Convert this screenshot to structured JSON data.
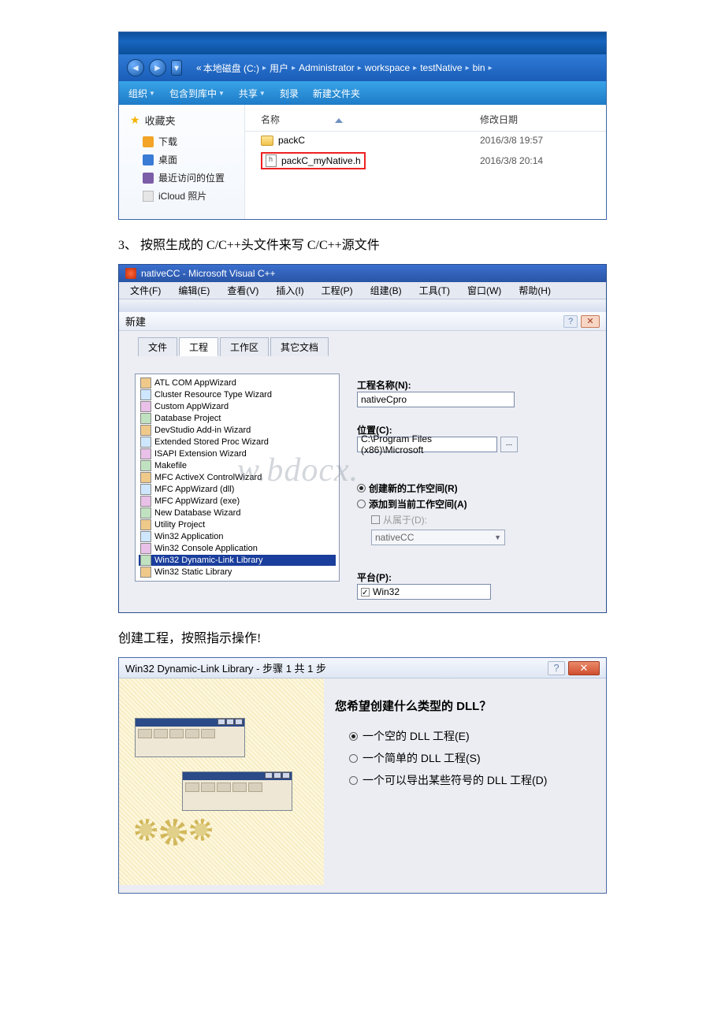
{
  "explorer": {
    "breadcrumb": {
      "prefix": "«",
      "parts": [
        "本地磁盘 (C:)",
        "用户",
        "Administrator",
        "workspace",
        "testNative",
        "bin"
      ]
    },
    "toolbar": {
      "org": "组织",
      "include": "包含到库中",
      "share": "共享",
      "burn": "刻录",
      "newfolder": "新建文件夹"
    },
    "favorites_label": "收藏夹",
    "nav": {
      "downloads": "下载",
      "desktop": "桌面",
      "recent": "最近访问的位置",
      "icloud": "iCloud 照片"
    },
    "cols": {
      "name": "名称",
      "date": "修改日期"
    },
    "rows": [
      {
        "name": "packC",
        "type": "folder",
        "date": "2016/3/8 19:57"
      },
      {
        "name": "packC_myNative.h",
        "type": "h",
        "date": "2016/3/8 20:14",
        "highlight": true
      }
    ]
  },
  "inst1_prefix": "3、",
  "inst1_body": "按照生成的 C/C++头文件来写 C/C++源文件",
  "vcpp": {
    "title": "nativeCC - Microsoft Visual C++",
    "menu": {
      "file": "文件(F)",
      "edit": "编辑(E)",
      "view": "查看(V)",
      "insert": "插入(I)",
      "project": "工程(P)",
      "build": "组建(B)",
      "tools": "工具(T)",
      "window": "窗口(W)",
      "help": "帮助(H)"
    },
    "dialog": {
      "title": "新建",
      "tabs": {
        "file": "文件",
        "project": "工程",
        "workspace": "工作区",
        "other": "其它文档"
      },
      "items": [
        "ATL COM AppWizard",
        "Cluster Resource Type Wizard",
        "Custom AppWizard",
        "Database Project",
        "DevStudio Add-in Wizard",
        "Extended Stored Proc Wizard",
        "ISAPI Extension Wizard",
        "Makefile",
        "MFC ActiveX ControlWizard",
        "MFC AppWizard (dll)",
        "MFC AppWizard (exe)",
        "New Database Wizard",
        "Utility Project",
        "Win32 Application",
        "Win32 Console Application",
        "Win32 Dynamic-Link Library",
        "Win32 Static Library"
      ],
      "selected_index": 15,
      "name_label": "工程名称(N):",
      "name_value": "nativeCpro",
      "loc_label": "位置(C):",
      "loc_value": "C:\\Program Files (x86)\\Microsoft",
      "radio_new": "创建新的工作空间(R)",
      "radio_add": "添加到当前工作空间(A)",
      "check_dep": "从属于(D):",
      "combo_value": "nativeCC",
      "platform_label": "平台(P):",
      "platform_value": "Win32"
    },
    "watermark": "w.bdocx."
  },
  "inst2": "创建工程，按照指示操作!",
  "wizard": {
    "title": "Win32 Dynamic-Link Library - 步骤 1 共 1 步",
    "question": "您希望创建什么类型的 DLL？",
    "opts": {
      "empty": "一个空的 DLL 工程(E)",
      "simple": "一个简单的 DLL 工程(S)",
      "export": "一个可以导出某些符号的 DLL 工程(D)"
    }
  }
}
